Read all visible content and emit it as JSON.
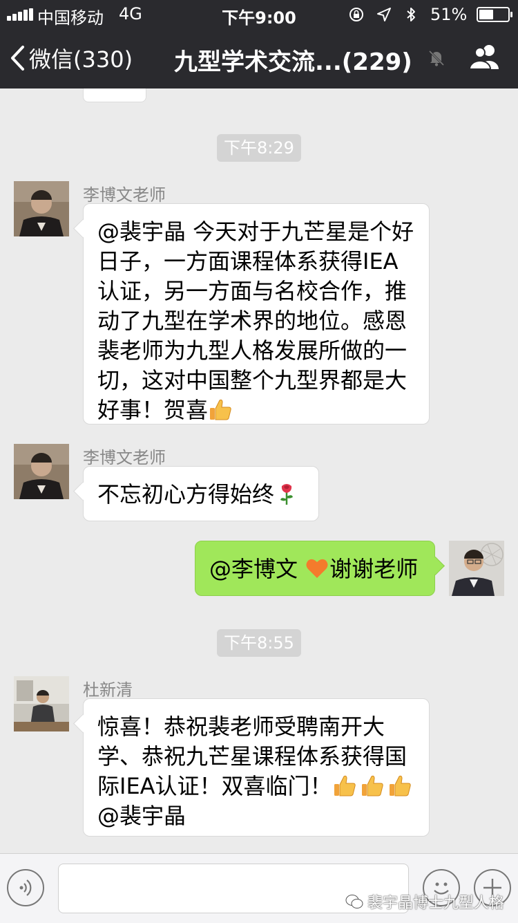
{
  "status_bar": {
    "carrier": "中国移动",
    "network": "4G",
    "time": "下午9:00",
    "battery": "51%",
    "battery_level": 0.51
  },
  "nav": {
    "back_label": "微信(330)",
    "title": "九型学术交流...(229)",
    "icons": [
      "back-chevron-icon",
      "mute-bell-icon",
      "group-members-icon"
    ]
  },
  "messages": [
    {
      "type": "time",
      "text": "下午8:29"
    },
    {
      "type": "message",
      "side": "left",
      "sender": "李博文老师",
      "lines": [
        "@裴宇晶 今天对于九芒星是个好",
        "日子，一方面课程体系获得IEA",
        "认证，另一方面与名校合作，推",
        "动了九型在学术界的地位。感恩",
        "裴老师为九型人格发展所做的一",
        "切，这对中国整个九型界都是大",
        "好事！贺喜"
      ],
      "emoji": "thumbs-up-icon"
    },
    {
      "type": "message",
      "side": "left",
      "sender": "李博文老师",
      "text": "不忘初心方得始终",
      "emoji": "rose-icon"
    },
    {
      "type": "message",
      "side": "right",
      "text_before": "@李博文 ",
      "emoji": "orange-heart-icon",
      "text_after": "谢谢老师"
    },
    {
      "type": "time",
      "text": "下午8:55"
    },
    {
      "type": "message",
      "side": "left",
      "sender": "杜新清",
      "lines": [
        "惊喜！恭祝裴老师受聘南开大",
        "学、恭祝九芒星课程体系获得国",
        "际IEA认证！双喜临门！",
        "@裴宇晶"
      ],
      "emoji": "thumbs-up-icon"
    }
  ],
  "input_bar": {
    "icons": [
      "voice-icon",
      "emoji-face-icon",
      "plus-icon"
    ]
  },
  "watermark": "裴宇晶博士九型人格",
  "colors": {
    "nav_bg": "#2a2a2e",
    "chat_bg": "#ebebeb",
    "my_bubble": "#a0e75a",
    "time_badge": "#d4d4d4"
  }
}
